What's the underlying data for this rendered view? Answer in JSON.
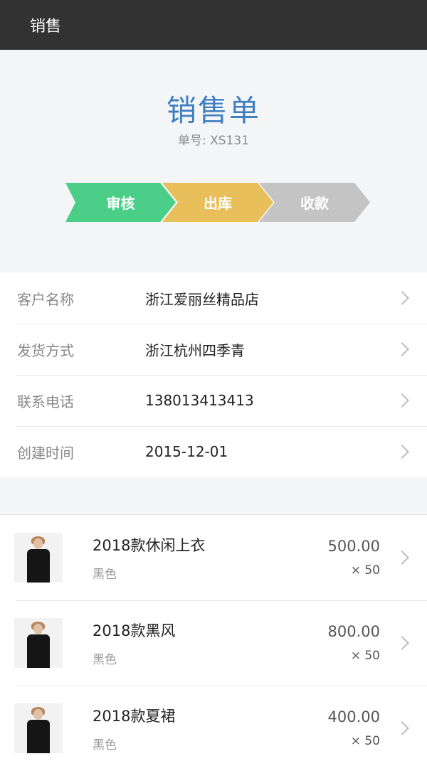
{
  "topbar": {
    "title": "销售"
  },
  "header": {
    "title": "销售单",
    "order_no": "单号: XS131",
    "steps": [
      "审核",
      "出库",
      "收款"
    ]
  },
  "info": [
    {
      "label": "客户名称",
      "value": "浙江爱丽丝精品店"
    },
    {
      "label": "发货方式",
      "value": "浙江杭州四季青"
    },
    {
      "label": "联系电话",
      "value": "138013413413"
    },
    {
      "label": "创建时间",
      "value": "2015-12-01"
    }
  ],
  "products": [
    {
      "name": "2018款休闲上衣",
      "color": "黑色",
      "price": "500.00",
      "qty": "× 50"
    },
    {
      "name": "2018款黑风",
      "color": "黑色",
      "price": "800.00",
      "qty": "× 50"
    },
    {
      "name": "2018款夏裙",
      "color": "黑色",
      "price": "400.00",
      "qty": "× 50"
    }
  ],
  "colors": {
    "topbar": "#323232",
    "title": "#3f7fc0",
    "step_review": "#4bcf88",
    "step_outbound": "#e8bf5a",
    "step_payment": "#c4c4c4"
  }
}
